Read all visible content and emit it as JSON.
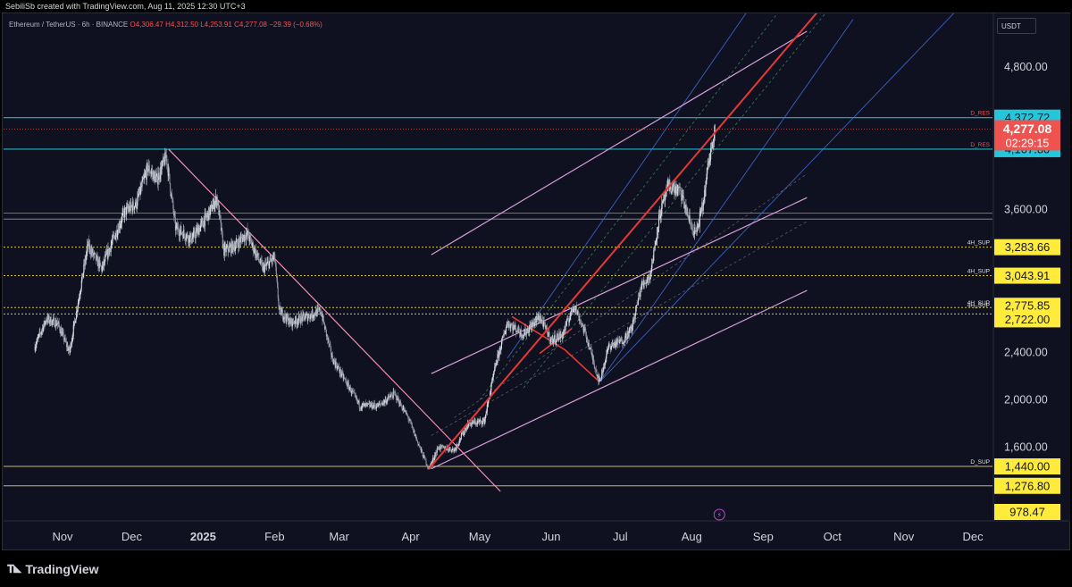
{
  "header": {
    "author_line": "SebiliSb created with TradingView.com, Aug 11, 2025 12:30 UTC+3"
  },
  "symbol_line": {
    "name": "Ethereum / TetherUS · 6h · BINANCE",
    "open": "O4,306.47",
    "high": "H4,312.50",
    "low": "L4,253.91",
    "close": "C4,277.08",
    "change": "−29.39 (−0.68%)"
  },
  "currency_button": "USDT",
  "footer": {
    "brand": "TradingView"
  },
  "colors": {
    "background": "#0f1120",
    "price_label_cyan": "#26c6da",
    "price_label_yellow": "#ffeb3b",
    "current_price_red": "#ef5350",
    "trendline_red": "#e53935",
    "channel_pink": "#e1a5e0",
    "channel_blue": "#3f6fd8",
    "descending_line": "#f48fb1"
  },
  "chart_data": {
    "type": "candlestick",
    "title": "Ethereum / TetherUS · 6h · BINANCE",
    "xlabel": "",
    "ylabel": "",
    "x_ticks": [
      "Nov",
      "Dec",
      "2025",
      "Feb",
      "Mar",
      "Apr",
      "May",
      "Jun",
      "Jul",
      "Aug",
      "Sep",
      "Oct",
      "Nov",
      "Dec"
    ],
    "y_ticks": [
      {
        "label": "4,800.00",
        "value": 4800
      },
      {
        "label": "3,600.00",
        "value": 3600
      },
      {
        "label": "2,400.00",
        "value": 2400
      },
      {
        "label": "2,000.00",
        "value": 2000
      },
      {
        "label": "1,600.00",
        "value": 1600
      }
    ],
    "current_price": {
      "value": 4277.08,
      "label": "4,277.08",
      "countdown": "02:29:15"
    },
    "levels": [
      {
        "value": 4372.72,
        "label": "4,372.72",
        "tag": "D_RES",
        "color": "cyan"
      },
      {
        "value": 4107.8,
        "label": "4,107.80",
        "tag": "D_RES",
        "color": "cyan"
      },
      {
        "value": 3283.66,
        "label": "3,283.66",
        "tag": "4H_SUP",
        "color": "yellow"
      },
      {
        "value": 3043.91,
        "label": "3,043.91",
        "tag": "4H_SUP",
        "color": "yellow"
      },
      {
        "value": 2775.85,
        "label": "2,775.85",
        "tag": "4H_SUP",
        "color": "yellow"
      },
      {
        "value": 2722.0,
        "label": "2,722.00",
        "tag": "4H_SUP",
        "color": "yellow"
      },
      {
        "value": 1440.0,
        "label": "1,440.00",
        "tag": "D_SUP",
        "color": "yellow"
      },
      {
        "value": 1276.8,
        "label": "1,276.80",
        "tag": "",
        "color": "yellow"
      },
      {
        "value": 978.47,
        "label": "978.47",
        "tag": "",
        "color": "yellow"
      }
    ],
    "price_path": [
      [
        "2024-10-20",
        2450
      ],
      [
        "2024-10-25",
        2680
      ],
      [
        "2024-10-30",
        2640
      ],
      [
        "2024-11-04",
        2400
      ],
      [
        "2024-11-08",
        2850
      ],
      [
        "2024-11-12",
        3300
      ],
      [
        "2024-11-18",
        3100
      ],
      [
        "2024-11-23",
        3350
      ],
      [
        "2024-11-28",
        3580
      ],
      [
        "2024-12-03",
        3650
      ],
      [
        "2024-12-08",
        3950
      ],
      [
        "2024-12-12",
        3850
      ],
      [
        "2024-12-16",
        4050
      ],
      [
        "2024-12-20",
        3450
      ],
      [
        "2024-12-27",
        3350
      ],
      [
        "2025-01-03",
        3550
      ],
      [
        "2025-01-07",
        3700
      ],
      [
        "2025-01-10",
        3250
      ],
      [
        "2025-01-15",
        3300
      ],
      [
        "2025-01-20",
        3400
      ],
      [
        "2025-01-27",
        3100
      ],
      [
        "2025-02-01",
        3200
      ],
      [
        "2025-02-03",
        2750
      ],
      [
        "2025-02-08",
        2650
      ],
      [
        "2025-02-15",
        2700
      ],
      [
        "2025-02-21",
        2750
      ],
      [
        "2025-02-26",
        2350
      ],
      [
        "2025-03-04",
        2150
      ],
      [
        "2025-03-10",
        1950
      ],
      [
        "2025-03-18",
        1950
      ],
      [
        "2025-03-25",
        2050
      ],
      [
        "2025-03-31",
        1850
      ],
      [
        "2025-04-06",
        1550
      ],
      [
        "2025-04-09",
        1420
      ],
      [
        "2025-04-13",
        1600
      ],
      [
        "2025-04-20",
        1580
      ],
      [
        "2025-04-26",
        1800
      ],
      [
        "2025-05-03",
        1820
      ],
      [
        "2025-05-08",
        2300
      ],
      [
        "2025-05-13",
        2650
      ],
      [
        "2025-05-20",
        2550
      ],
      [
        "2025-05-27",
        2700
      ],
      [
        "2025-06-01",
        2500
      ],
      [
        "2025-06-06",
        2550
      ],
      [
        "2025-06-11",
        2800
      ],
      [
        "2025-06-16",
        2550
      ],
      [
        "2025-06-22",
        2150
      ],
      [
        "2025-06-26",
        2450
      ],
      [
        "2025-07-02",
        2500
      ],
      [
        "2025-07-06",
        2600
      ],
      [
        "2025-07-10",
        2950
      ],
      [
        "2025-07-14",
        3050
      ],
      [
        "2025-07-18",
        3550
      ],
      [
        "2025-07-22",
        3800
      ],
      [
        "2025-07-27",
        3750
      ],
      [
        "2025-08-01",
        3450
      ],
      [
        "2025-08-03",
        3400
      ],
      [
        "2025-08-06",
        3650
      ],
      [
        "2025-08-08",
        3950
      ],
      [
        "2025-08-11",
        4300
      ]
    ],
    "annotations": [
      {
        "type": "descending_trendline",
        "from": [
          "2024-12-17",
          4108
        ],
        "to": [
          "2025-05-10",
          1230
        ]
      },
      {
        "type": "uptrend_line",
        "from": [
          "2025-04-09",
          1420
        ],
        "to": [
          "2025-10-05",
          5500
        ]
      },
      {
        "type": "channel",
        "color": "pink"
      },
      {
        "type": "pitchfork",
        "color": "blue"
      }
    ]
  }
}
